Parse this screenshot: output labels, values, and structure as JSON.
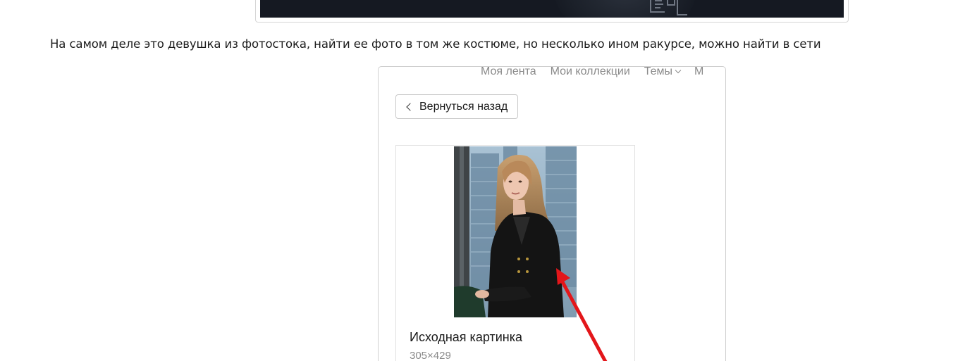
{
  "article": {
    "paragraph": "На самом деле это девушка из фотостока, найти ее фото в том же костюме, но несколько ином ракурсе, можно найти в сети"
  },
  "embed": {
    "nav": [
      {
        "label": "Моя лента"
      },
      {
        "label": "Мои коллекции"
      },
      {
        "label": "Темы"
      },
      {
        "label": "М"
      }
    ],
    "back_button": "Вернуться назад",
    "card": {
      "title": "Исходная картинка",
      "size": "305×429"
    }
  },
  "colors": {
    "arrow": "#e3161a",
    "top_shot_bg": "#151922",
    "nav_text": "#8a8a8a"
  }
}
